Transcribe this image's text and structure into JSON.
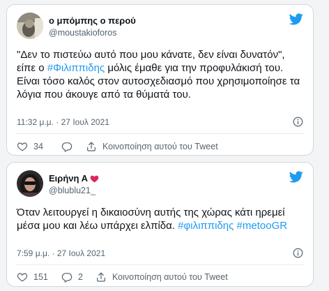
{
  "colors": {
    "accent": "#1d9bf0",
    "text": "#0f1419",
    "muted": "#536471",
    "heart": "#e0245e"
  },
  "tweets": [
    {
      "author_name": "ο μπόμπης ο περού",
      "handle": "@moustakioforos",
      "text_before": "\"Δεν το πιστεύω αυτό που μου κάνατε, δεν είναι δυνατόν\", είπε ο ",
      "hashtag": "#Φιλιππιδης",
      "text_after": " μόλις έμαθε για την προφυλάκισή του.",
      "text_line2": "Είναι τόσο καλός στον αυτοσχεδιασμό που χρησιμοποίησε τα λόγια που άκουγε από τα θύματά του.",
      "timestamp": "11:32 μ.μ. · 27 Ιουλ 2021",
      "likes": "34",
      "share_label": "Κοινοποίηση αυτού του Tweet"
    },
    {
      "author_name": "Ειρήνη Α",
      "name_emoji": "heart-icon",
      "handle": "@blublu21_",
      "text_main": "Όταν λειτουργεί η δικαιοσύνη  αυτής της χώρας κάτι ηρεμεί μέσα μου και λέω υπάρχει ελπίδα. ",
      "hashtag_1": "#φιλιππιδης",
      "hashtag_2": "#metooGR",
      "timestamp": "7:59 μ.μ. · 27 Ιουλ 2021",
      "likes": "151",
      "replies": "2",
      "share_label": "Κοινοποίηση αυτού του Tweet"
    }
  ]
}
